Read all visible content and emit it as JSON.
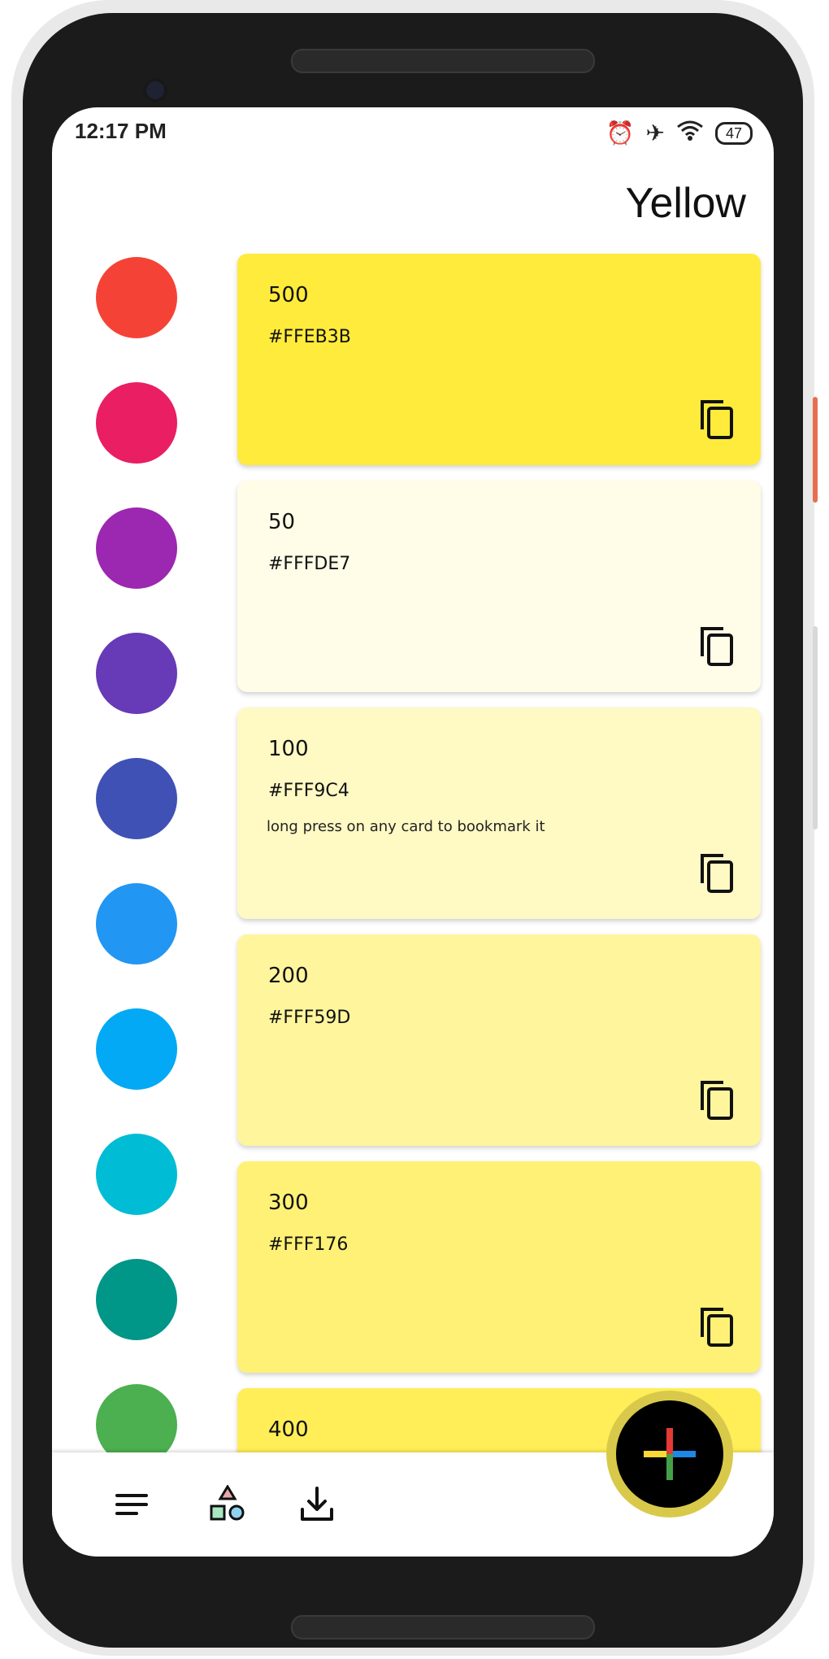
{
  "status_bar": {
    "time": "12:17 PM",
    "battery": "47",
    "icons": [
      "alarm-icon",
      "airplane-icon",
      "wifi-icon",
      "battery-icon"
    ]
  },
  "header": {
    "title": "Yellow"
  },
  "palette_dots": [
    {
      "name": "red",
      "color": "#F44336"
    },
    {
      "name": "pink",
      "color": "#E91E63"
    },
    {
      "name": "purple",
      "color": "#9C27B0"
    },
    {
      "name": "deep-purple",
      "color": "#673AB7"
    },
    {
      "name": "indigo",
      "color": "#3F51B5"
    },
    {
      "name": "blue",
      "color": "#2196F3"
    },
    {
      "name": "light-blue",
      "color": "#03A9F4"
    },
    {
      "name": "cyan",
      "color": "#00BCD4"
    },
    {
      "name": "teal",
      "color": "#009688"
    },
    {
      "name": "green",
      "color": "#4CAF50"
    }
  ],
  "cards": [
    {
      "weight": "500",
      "hex": "#FFEB3B",
      "bg": "#FFEB3B",
      "hint": ""
    },
    {
      "weight": "50",
      "hex": "#FFFDE7",
      "bg": "#FFFDE7",
      "hint": ""
    },
    {
      "weight": "100",
      "hex": "#FFF9C4",
      "bg": "#FFF9C4",
      "hint": "long press on any card to bookmark it"
    },
    {
      "weight": "200",
      "hex": "#FFF59D",
      "bg": "#FFF59D",
      "hint": ""
    },
    {
      "weight": "300",
      "hex": "#FFF176",
      "bg": "#FFF176",
      "hint": ""
    },
    {
      "weight": "400",
      "hex": "",
      "bg": "#FFEE58",
      "hint": ""
    }
  ],
  "bottom_nav": {
    "icons": [
      "menu-icon",
      "shapes-icon",
      "download-icon"
    ]
  },
  "fab": {
    "icon": "plus-icon"
  }
}
